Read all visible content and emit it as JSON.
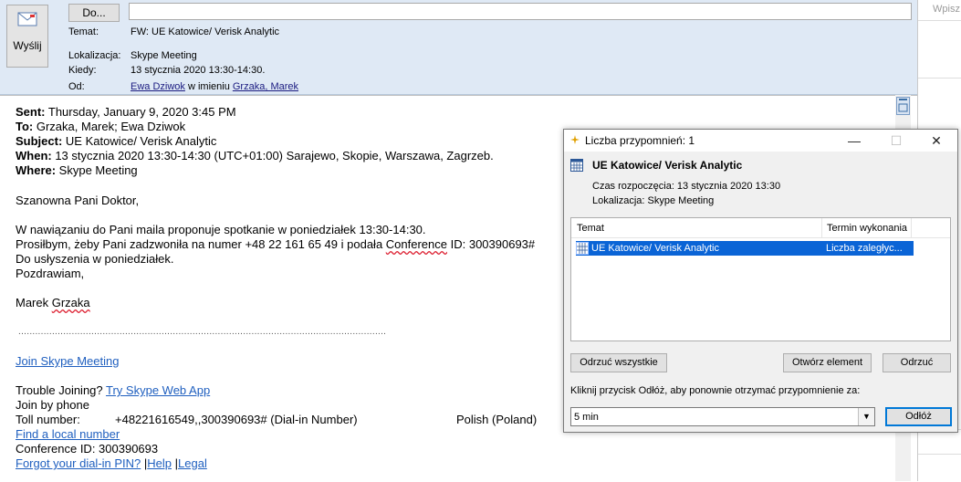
{
  "header": {
    "send_label": "Wyślij",
    "do_label": "Do...",
    "to_value": "",
    "subject_label": "Temat:",
    "subject_value": "FW: UE Katowice/ Verisk Analytic",
    "location_label": "Lokalizacja:",
    "location_value": "Skype Meeting",
    "when_label": "Kiedy:",
    "when_value": "13 stycznia 2020 13:30-14:30.",
    "from_label": "Od:",
    "from_sender": "Ewa Dziwok",
    "from_middle": " w imieniu ",
    "from_owner": "Grzaka, Marek"
  },
  "right_pane": {
    "search_placeholder": "Wpisz"
  },
  "body": {
    "sent_label": "Sent:",
    "sent_value": " Thursday, January 9, 2020 3:45 PM",
    "to_label": "To:",
    "to_value": " Grzaka, Marek; Ewa Dziwok",
    "subject_label": "Subject:",
    "subject_value": " UE Katowice/ Verisk Analytic",
    "when_label": "When:",
    "when_value": " 13 stycznia 2020 13:30-14:30 (UTC+01:00) Sarajewo, Skopie, Warszawa, Zagrzeb.",
    "where_label": "Where:",
    "where_value": " Skype Meeting",
    "greeting": "Szanowna Pani Doktor,",
    "line1": "W nawiązaniu do Pani maila proponuje spotkanie w poniedziałek 13:30-14:30.",
    "line2_a": "Prosiłbym, żeby Pani zadzwoniła na numer  +48 22 161 65 49 i podała ",
    "line2_conf": "Conference",
    "line2_b": " ID: 300390693#",
    "line3": "Do usłyszenia w poniedziałek.",
    "line4": "Pozdrawiam,",
    "signature_first": "Marek ",
    "signature_last": "Grzaka",
    "separator": "...................................................................................................................................",
    "join_link": "Join Skype Meeting",
    "trouble_text": "Trouble Joining? ",
    "trouble_link": "Try Skype Web App",
    "join_phone": "Join by phone",
    "toll_label": "Toll number:",
    "toll_value": "+48221616549,,300390693# (Dial-in Number)",
    "toll_lang": "Polish (Poland)",
    "local_link": "Find a local number",
    "conf_id": "Conference ID: 300390693",
    "forgot_link": "Forgot your dial-in PIN?",
    "help_link": "Help",
    "legal_link": "Legal",
    "sep_pipe1": " |",
    "sep_pipe2": "  |"
  },
  "dialog": {
    "title": "Liczba przypomnień: 1",
    "item_title": "UE Katowice/ Verisk Analytic",
    "start_label": "Czas rozpoczęcia: 13 stycznia 2020 13:30",
    "location_label": "Lokalizacja: Skype Meeting",
    "col_subject": "Temat",
    "col_due": "Termin wykonania",
    "row_subject": "UE Katowice/ Verisk Analytic",
    "row_due": "Liczba zaległyc...",
    "dismiss_all": "Odrzuć wszystkie",
    "open_item": "Otwórz element",
    "dismiss": "Odrzuć",
    "snooze_prompt": "Kliknij przycisk Odłóż, aby ponownie otrzymać przypomnienie za:",
    "snooze_value": "5 min",
    "snooze_button": "Odłóż"
  }
}
